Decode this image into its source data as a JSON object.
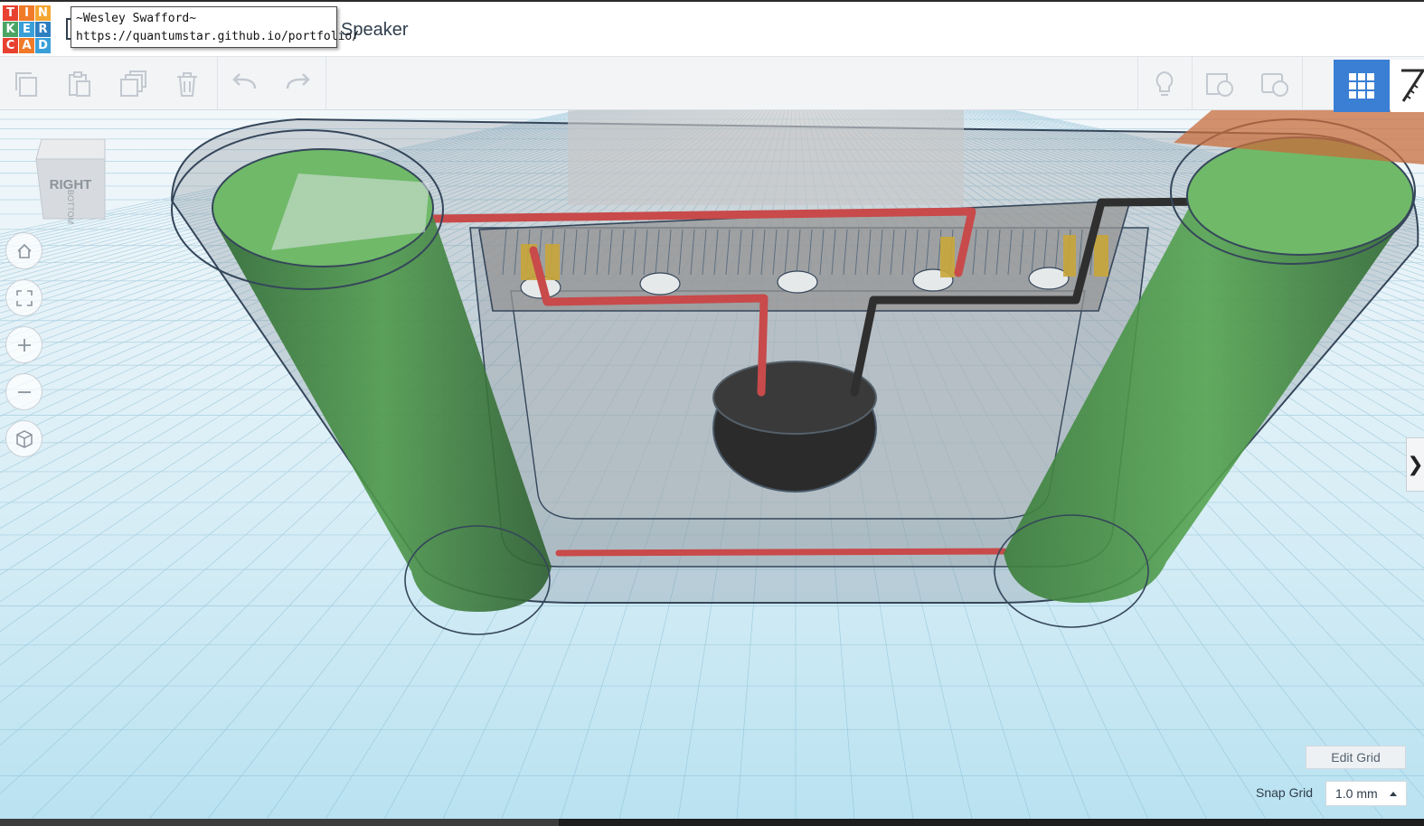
{
  "header": {
    "logo_letters": [
      "T",
      "I",
      "N",
      "K",
      "E",
      "R",
      "C",
      "A",
      "D"
    ],
    "logo_colors": [
      "#e8412f",
      "#f07a28",
      "#f4a631",
      "#4aa564",
      "#3a9fd8",
      "#2d7fc1",
      "#e8412f",
      "#f07a28",
      "#3a9fd8"
    ],
    "title": "Speaker",
    "tooltip_line1": "~Wesley Swafford~",
    "tooltip_line2": "https://quantumstar.github.io/portfolio/"
  },
  "toolbar": {
    "left_icons": [
      "copy-icon",
      "paste-icon",
      "duplicate-icon",
      "delete-icon",
      "undo-icon",
      "redo-icon"
    ],
    "right_icons": [
      "lightbulb-icon",
      "notes-icon",
      "shape-icon"
    ],
    "grid_icon": "grid-view-icon",
    "ruler_icon": "ruler-icon"
  },
  "viewcube": {
    "face_right": "RIGHT",
    "face_bottom": "BOTTOM"
  },
  "nav_controls": [
    "home-icon",
    "fit-view-icon",
    "zoom-in-icon",
    "zoom-out-icon",
    "perspective-icon"
  ],
  "side_tab_glyph": "❯",
  "grid_controls": {
    "edit_grid_label": "Edit Grid",
    "snap_grid_label": "Snap Grid",
    "snap_grid_value": "1.0 mm"
  },
  "colors": {
    "accent_blue": "#3a7fd4",
    "wire_red": "#c84a4a",
    "wire_black": "#2a2a2a",
    "tube_green": "#3f8a3f",
    "speaker_black": "#2b2b2b"
  }
}
